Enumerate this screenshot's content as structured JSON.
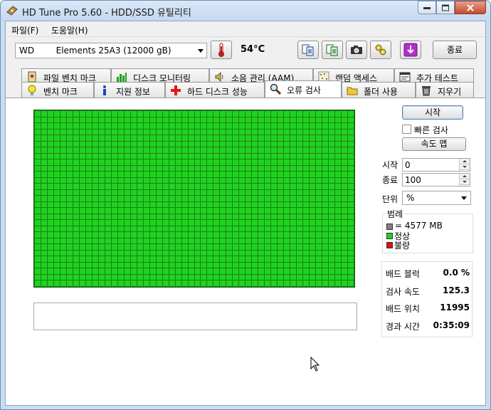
{
  "window": {
    "title": "HD Tune Pro 5.60 - HDD/SSD 유틸리티"
  },
  "menu": {
    "file": "파일(F)",
    "help": "도움말(H)"
  },
  "toolbar": {
    "drive": "WD        Elements 25A3 (12000 gB)",
    "temperature": "54°C",
    "exit": "종료",
    "icons": [
      "copy-info-icon",
      "copy-screen-icon",
      "screenshot-camera-icon",
      "options-wrench-icon",
      "save-download-icon"
    ]
  },
  "tabs_row1": [
    "파일 벤치 마크",
    "디스크 모니터링",
    "소음 관리 (AAM)",
    "랜덤 액세스",
    "추가 테스트"
  ],
  "tabs_row2": [
    "벤치 마크",
    "지원 정보",
    "하드 디스크 성능",
    "오류 검사",
    "폴더 사용",
    "지우기"
  ],
  "active_tab": "오류 검사",
  "scan": {
    "start_button": "시작",
    "quick_scan_label": "빠른 검사",
    "quick_scan_checked": false,
    "speed_map_button": "속도 맵",
    "start_label": "시작",
    "start_value": "0",
    "end_label": "종료",
    "end_value": "100",
    "unit_label": "단위",
    "unit_value": "%",
    "grid_status": "all-ok"
  },
  "legend": {
    "title": "범례",
    "block_size": "= 4577 MB",
    "ok": "정상",
    "bad": "불량",
    "colors": {
      "block": "#808080",
      "ok": "#1ed41e",
      "bad": "#e01010"
    }
  },
  "stats": {
    "bad_blocks_label": "배드 블럭",
    "bad_blocks_value": "0.0 %",
    "scan_speed_label": "검사 속도",
    "scan_speed_value": "125.3",
    "bad_position_label": "배드 위치",
    "bad_position_value": "11995",
    "elapsed_label": "경과 시간",
    "elapsed_value": "0:35:09"
  }
}
